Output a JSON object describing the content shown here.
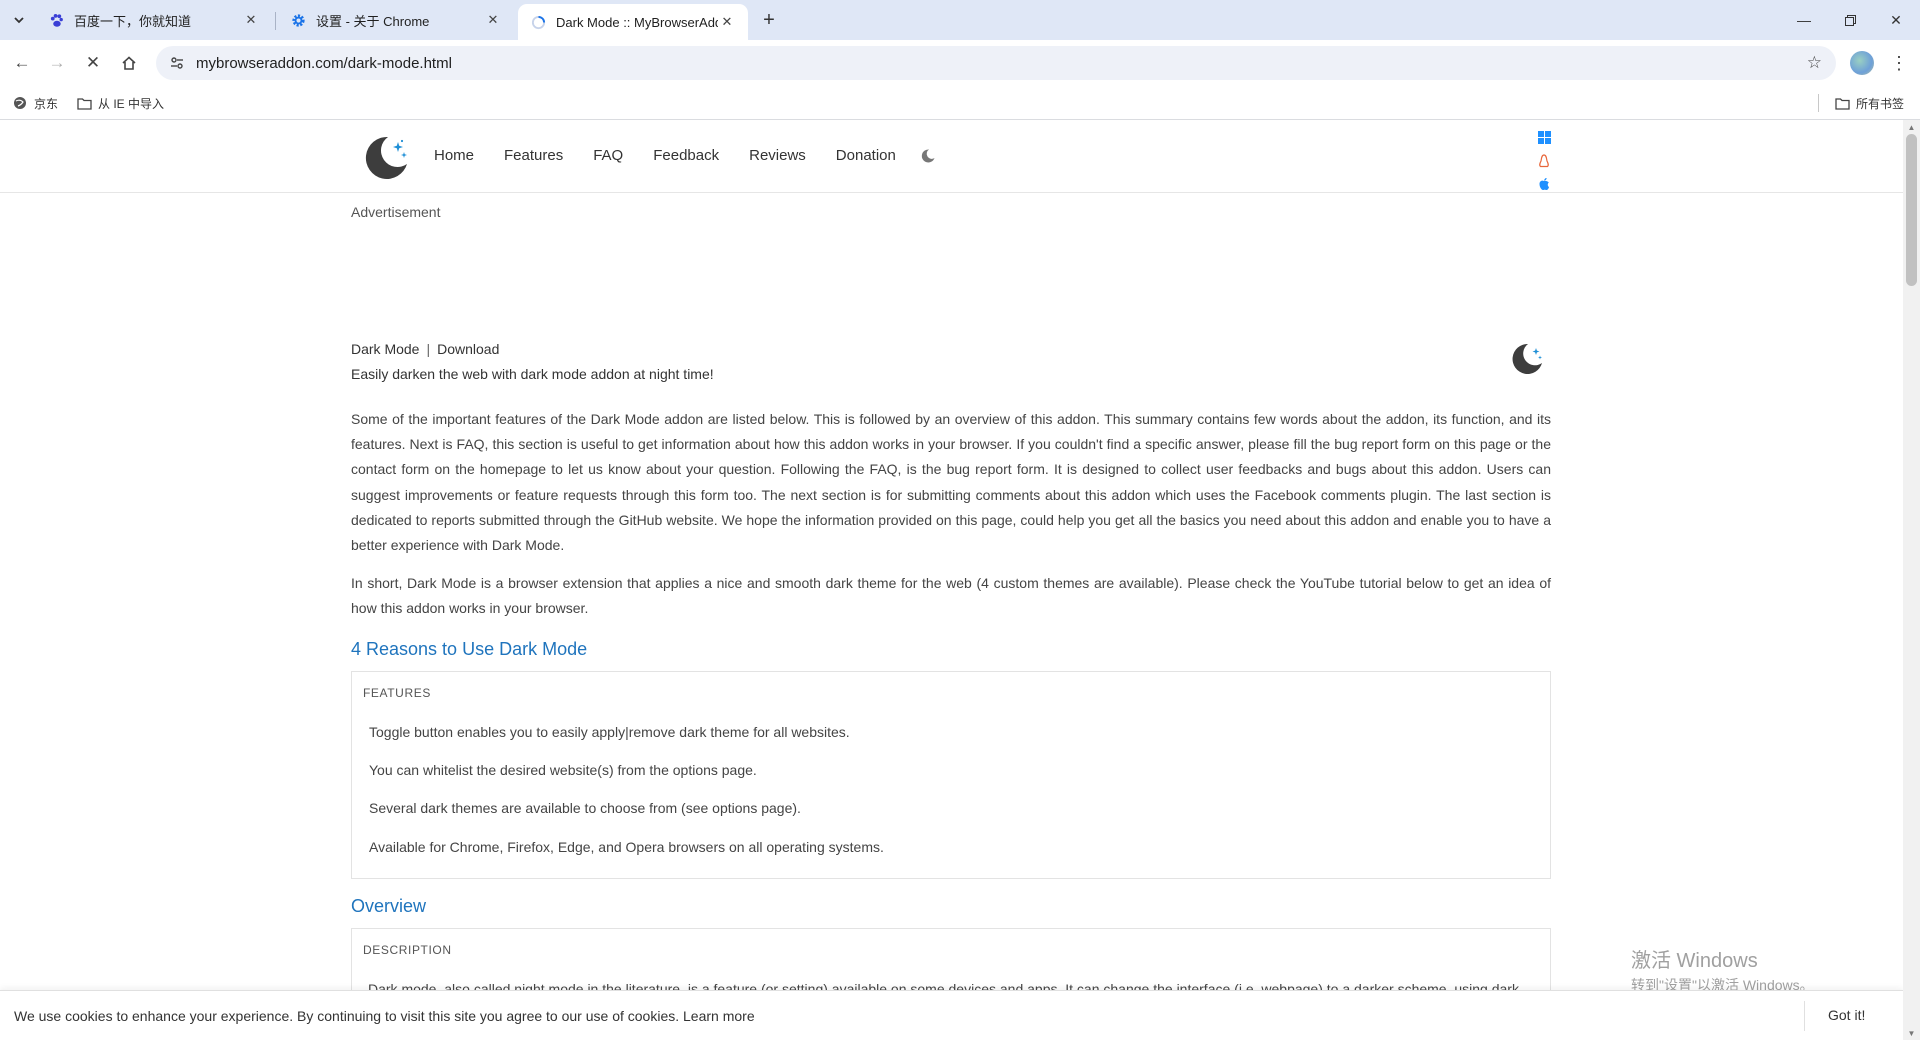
{
  "tabs": [
    {
      "title": "百度一下，你就知道",
      "active": false
    },
    {
      "title": "设置 - 关于 Chrome",
      "active": false
    },
    {
      "title": "Dark Mode :: MyBrowserAddon",
      "active": true
    }
  ],
  "toolbar": {
    "url": "mybrowseraddon.com/dark-mode.html"
  },
  "bookmarks": {
    "items": [
      "京东",
      "从 IE 中导入"
    ],
    "all_bookmarks": "所有书签"
  },
  "site": {
    "nav": [
      "Home",
      "Features",
      "FAQ",
      "Feedback",
      "Reviews",
      "Donation"
    ],
    "advertisement": "Advertisement",
    "crumbs": {
      "name": "Dark Mode",
      "sep": "|",
      "download": "Download"
    },
    "tagline": "Easily darken the web with dark mode addon at night time!",
    "para1": "Some of the important features of the Dark Mode addon are listed below. This is followed by an overview of this addon. This summary contains few words about the addon, its function, and its features. Next is FAQ, this section is useful to get information about how this addon works in your browser. If you couldn't find a specific answer, please fill the bug report form on this page or the contact form on the homepage to let us know about your question. Following the FAQ, is the bug report form. It is designed to collect user feedbacks and bugs about this addon. Users can suggest improvements or feature requests through this form too. The next section is for submitting comments about this addon which uses the Facebook comments plugin. The last section is dedicated to reports submitted through the GitHub website. We hope the information provided on this page, could help you get all the basics you need about this addon and enable you to have a better experience with Dark Mode.",
    "para2": "In short, Dark Mode is a browser extension that applies a nice and smooth dark theme for the web (4 custom themes are available). Please check the YouTube tutorial below to get an idea of how this addon works in your browser.",
    "reasons_title": "4 Reasons to Use Dark Mode",
    "features_head": "FEATURES",
    "features": [
      "Toggle button enables you to easily apply|remove dark theme for all websites.",
      "You can whitelist the desired website(s) from the options page.",
      "Several dark themes are available to choose from (see options page).",
      "Available for Chrome, Firefox, Edge, and Opera browsers on all operating systems."
    ],
    "overview_title": "Overview",
    "description_head": "DESCRIPTION",
    "description_text": "Dark mode, also called night mode in the literature, is a feature (or setting) available on some devices and apps. It can change the interface (i.e. webpage) to a darker scheme, using dark"
  },
  "cookie": {
    "message": "We use cookies to enhance your experience. By continuing to visit this site you agree to our use of cookies.",
    "learn_more": "Learn more",
    "button": "Got it!"
  },
  "watermark": {
    "line1": "激活 Windows",
    "line2": "转到\"设置\"以激活 Windows。"
  },
  "colors": {
    "accent": "#1f74bd",
    "tabstrip": "#dfe7f6",
    "omnibox": "#eef1f8"
  }
}
